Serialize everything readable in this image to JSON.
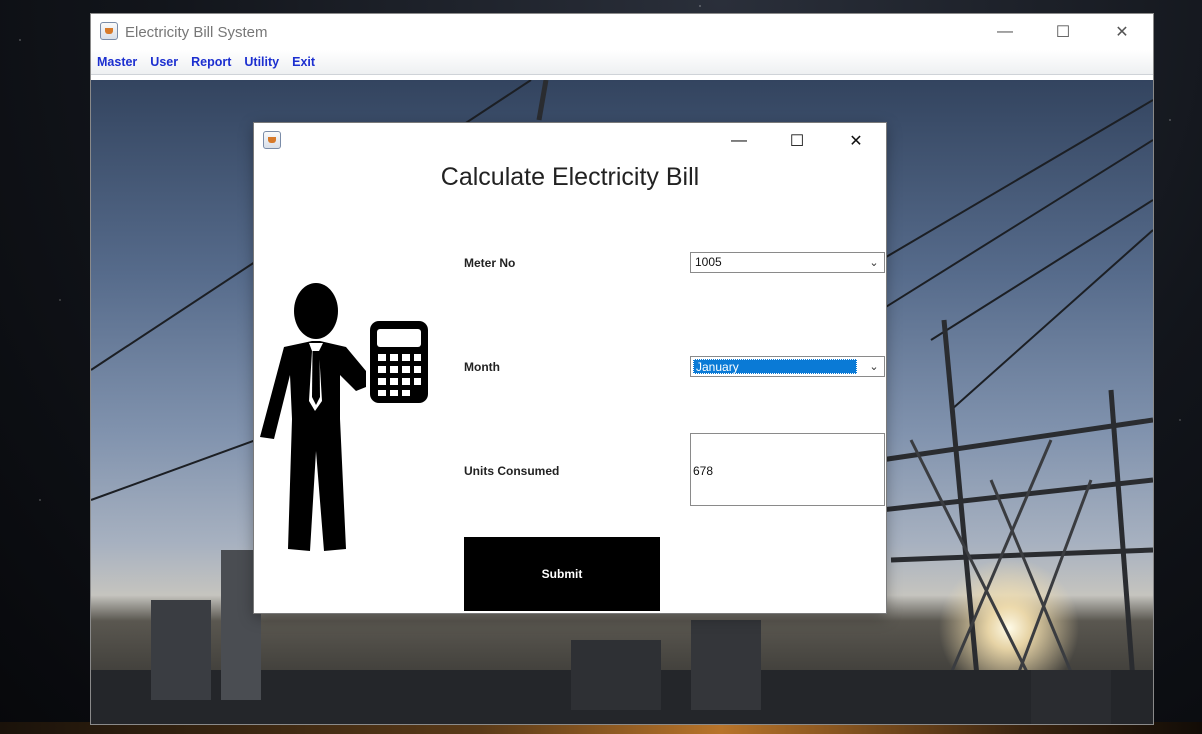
{
  "window": {
    "title": "Electricity Bill System",
    "controls": {
      "minimize": "—",
      "maximize": "☐",
      "close": "✕"
    }
  },
  "menu": {
    "items": [
      "Master",
      "User",
      "Report",
      "Utility",
      "Exit"
    ]
  },
  "dialog": {
    "heading": "Calculate Electricity Bill",
    "controls": {
      "minimize": "—",
      "maximize": "☐",
      "close": "✕"
    },
    "meter_label": "Meter No",
    "meter_value": "1005",
    "month_label": "Month",
    "month_value": "January",
    "units_label": "Units Consumed",
    "units_value": "678",
    "submit_label": "Submit",
    "dropdown_arrow": "⌄"
  },
  "icons": [
    "java-app-icon",
    "minimize-icon",
    "maximize-icon",
    "close-icon",
    "chevron-down-icon",
    "man-with-calculator-illustration"
  ],
  "colors": {
    "menu_text": "#1c2fd0",
    "selection": "#0a7ad6",
    "submit_bg": "#000000"
  }
}
